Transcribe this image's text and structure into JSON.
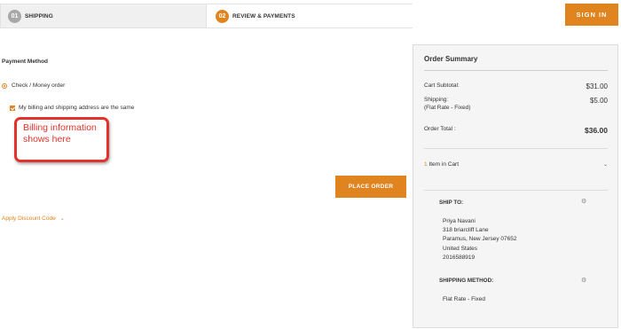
{
  "steps": [
    {
      "num": "01",
      "label": "SHIPPING"
    },
    {
      "num": "02",
      "label": "REVIEW & PAYMENTS"
    }
  ],
  "header": {
    "signin_label": "SIGN IN"
  },
  "payment": {
    "title": "Payment Method",
    "method_label": "Check / Money order",
    "same_address_label": "My billing and shipping address are the same",
    "place_order_label": "PLACE ORDER",
    "discount_label": "Apply Discount Code"
  },
  "callout": {
    "text": "Billing information shows here"
  },
  "summary": {
    "title": "Order Summary",
    "cart_subtotal_label": "Cart Subtotal:",
    "cart_subtotal_value": "$31.00",
    "shipping_label": "Shipping:",
    "shipping_sublabel": "(Flat Rate - Fixed)",
    "shipping_value": "$5.00",
    "order_total_label": "Order Total :",
    "order_total_value": "$36.00",
    "cart_count": "1",
    "cart_label": "Item in Cart"
  },
  "ship_to": {
    "title": "SHIP TO:",
    "name": "Priya Navani",
    "street": "318 briarcliff Lane",
    "city": "Paramus, New Jersey 07652",
    "country": "United States",
    "phone": "2016588919"
  },
  "shipping_method": {
    "title": "SHIPPING METHOD:",
    "value": "Flat Rate - Fixed"
  },
  "colors": {
    "accent": "#e08420",
    "callout": "#e2322b",
    "step_inactive": "#a8a8a8"
  },
  "icons": [
    "radio-selected",
    "checkbox-checked",
    "chevron-down-icon",
    "gear-icon"
  ]
}
